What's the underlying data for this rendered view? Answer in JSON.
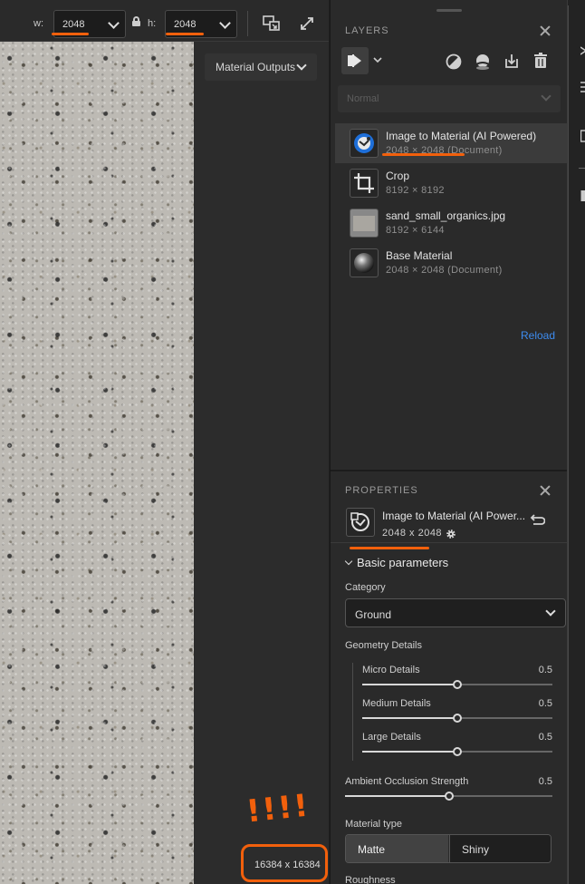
{
  "toolbar": {
    "width_label": "w:",
    "width_value": "2048",
    "height_label": "h:",
    "height_value": "2048",
    "accent_color": "#f2600c"
  },
  "canvas": {
    "output_dropdown": "Material Outputs",
    "annotation": "!!!!",
    "resolution": "16384 x 16384"
  },
  "layers": {
    "title": "LAYERS",
    "blend_mode": "Normal",
    "items": [
      {
        "name": "Image to Material (AI Powered)",
        "dims": "2048 × 2048 (Document)",
        "icon": "ai-material-icon",
        "selected": true
      },
      {
        "name": "Crop",
        "dims": "8192 × 8192",
        "icon": "crop-icon",
        "selected": false
      },
      {
        "name": "sand_small_organics.jpg",
        "dims": "8192 × 6144",
        "icon": "image-thumbnail",
        "selected": false
      },
      {
        "name": "Base Material",
        "dims": "2048 × 2048 (Document)",
        "icon": "sphere-icon",
        "selected": false
      }
    ],
    "reload": "Reload",
    "link_color": "#3d8cf0"
  },
  "properties": {
    "title": "PROPERTIES",
    "layer_name": "Image to Material (AI Power...",
    "dims": "2048 x 2048",
    "section": "Basic parameters",
    "category_label": "Category",
    "category_value": "Ground",
    "geometry_label": "Geometry Details",
    "sliders": [
      {
        "name": "Micro Details",
        "value": "0.5",
        "fraction": 0.5
      },
      {
        "name": "Medium Details",
        "value": "0.5",
        "fraction": 0.5
      },
      {
        "name": "Large Details",
        "value": "0.5",
        "fraction": 0.5
      }
    ],
    "ao": {
      "name": "Ambient Occlusion Strength",
      "value": "0.5",
      "fraction": 0.5
    },
    "material_type_label": "Material type",
    "material_types": [
      "Matte",
      "Shiny"
    ],
    "material_type_selected": "Matte",
    "next_label": "Roughness"
  }
}
